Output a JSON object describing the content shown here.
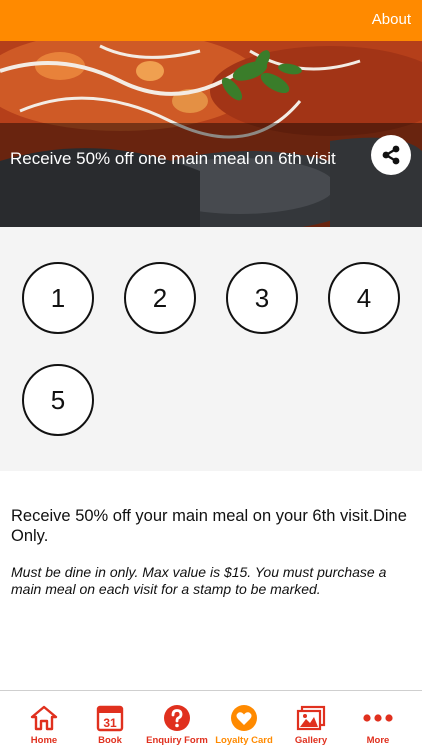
{
  "header": {
    "about_label": "About"
  },
  "offer": {
    "title": "Receive 50% off one main meal on 6th visit",
    "description": "Receive 50% off your main meal on your 6th visit.Dine Only.",
    "terms": "Must be dine in only. Max value is $15. You must purchase a main meal on each visit for a stamp to be marked."
  },
  "stamps": [
    "1",
    "2",
    "3",
    "4",
    "5"
  ],
  "tabs": [
    {
      "label": "Home",
      "icon": "home-icon"
    },
    {
      "label": "Book",
      "icon": "calendar-icon",
      "calendar_day": "31"
    },
    {
      "label": "Enquiry Form",
      "icon": "question-icon"
    },
    {
      "label": "Loyalty Card",
      "icon": "heart-icon",
      "active": true
    },
    {
      "label": "Gallery",
      "icon": "gallery-icon"
    },
    {
      "label": "More",
      "icon": "more-dots-icon"
    }
  ],
  "colors": {
    "accent": "#ff8a00",
    "tab_icon": "#e0301e",
    "active_tab": "#ff8a00"
  }
}
